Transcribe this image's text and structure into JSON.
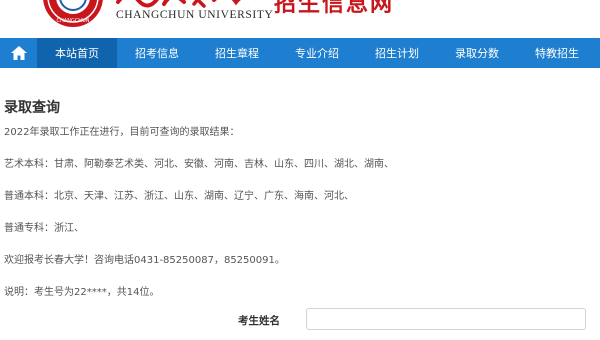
{
  "header": {
    "university_name_en": "CHANGCHUN UNIVERSITY",
    "site_title": "招生信息网",
    "brand_red": "#c8161d"
  },
  "nav": {
    "color": "#1e7fd0",
    "active_color": "#0f64ad",
    "home_icon": "home-icon",
    "items": [
      {
        "label": "本站首页",
        "active": true
      },
      {
        "label": "招考信息",
        "active": false
      },
      {
        "label": "招生章程",
        "active": false
      },
      {
        "label": "专业介绍",
        "active": false
      },
      {
        "label": "招生计划",
        "active": false
      },
      {
        "label": "录取分数",
        "active": false
      },
      {
        "label": "特教招生",
        "active": false
      }
    ]
  },
  "content": {
    "title": "录取查询",
    "intro": "2022年录取工作正在进行，目前可查询的录取结果：",
    "art_undergrad": "艺术本科：甘肃、阿勒泰艺术类、河北、安徽、河南、吉林、山东、四川、湖北、湖南、",
    "general_undergrad": "普通本科：北京、天津、江苏、浙江、山东、湖南、辽宁、广东、海南、河北、",
    "general_college": "普通专科：浙江、",
    "welcome": "欢迎报考长春大学！咨询电话0431-85250087，85250091。",
    "note": "说明：考生号为22****，共14位。"
  },
  "form": {
    "name_label": "考生姓名",
    "name_value": ""
  }
}
